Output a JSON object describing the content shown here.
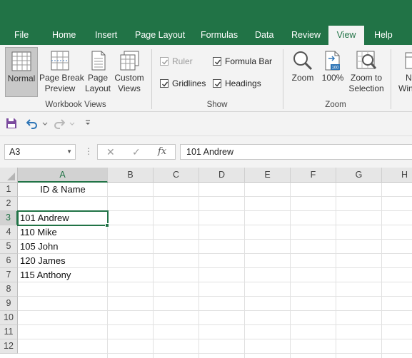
{
  "tabs": [
    {
      "label": "File"
    },
    {
      "label": "Home"
    },
    {
      "label": "Insert"
    },
    {
      "label": "Page Layout"
    },
    {
      "label": "Formulas"
    },
    {
      "label": "Data"
    },
    {
      "label": "Review"
    },
    {
      "label": "View",
      "active": true
    },
    {
      "label": "Help"
    }
  ],
  "ribbon": {
    "workbook_views": {
      "group_label": "Workbook Views",
      "normal": {
        "line1": "Normal"
      },
      "page_break": {
        "line1": "Page Break",
        "line2": "Preview"
      },
      "page_layout": {
        "line1": "Page",
        "line2": "Layout"
      },
      "custom_views": {
        "line1": "Custom",
        "line2": "Views"
      }
    },
    "show": {
      "group_label": "Show",
      "ruler": {
        "label": "Ruler",
        "checked": true,
        "disabled": true
      },
      "formula_bar": {
        "label": "Formula Bar",
        "checked": true
      },
      "gridlines": {
        "label": "Gridlines",
        "checked": true
      },
      "headings": {
        "label": "Headings",
        "checked": true
      }
    },
    "zoom": {
      "group_label": "Zoom",
      "zoom": {
        "line1": "Zoom"
      },
      "hundred": {
        "line1": "100%",
        "badge": "100"
      },
      "to_selection": {
        "line1": "Zoom to",
        "line2": "Selection"
      }
    },
    "window": {
      "new_window": {
        "line1": "N",
        "line2": "Win"
      }
    }
  },
  "name_box": {
    "value": "A3"
  },
  "formula_bar": {
    "fx": "fx",
    "value": "101 Andrew"
  },
  "columns": [
    "A",
    "B",
    "C",
    "D",
    "E",
    "F",
    "G",
    "H"
  ],
  "rows": [
    "1",
    "2",
    "3",
    "4",
    "5",
    "6",
    "7",
    "8",
    "9",
    "10",
    "11",
    "12"
  ],
  "cells": {
    "A1": "ID & Name",
    "A3": "101 Andrew",
    "A4": "110 Mike",
    "A5": "105 John",
    "A6": "120 James",
    "A7": "115 Anthony"
  },
  "active_cell": "A3",
  "colors": {
    "accent": "#217346"
  }
}
